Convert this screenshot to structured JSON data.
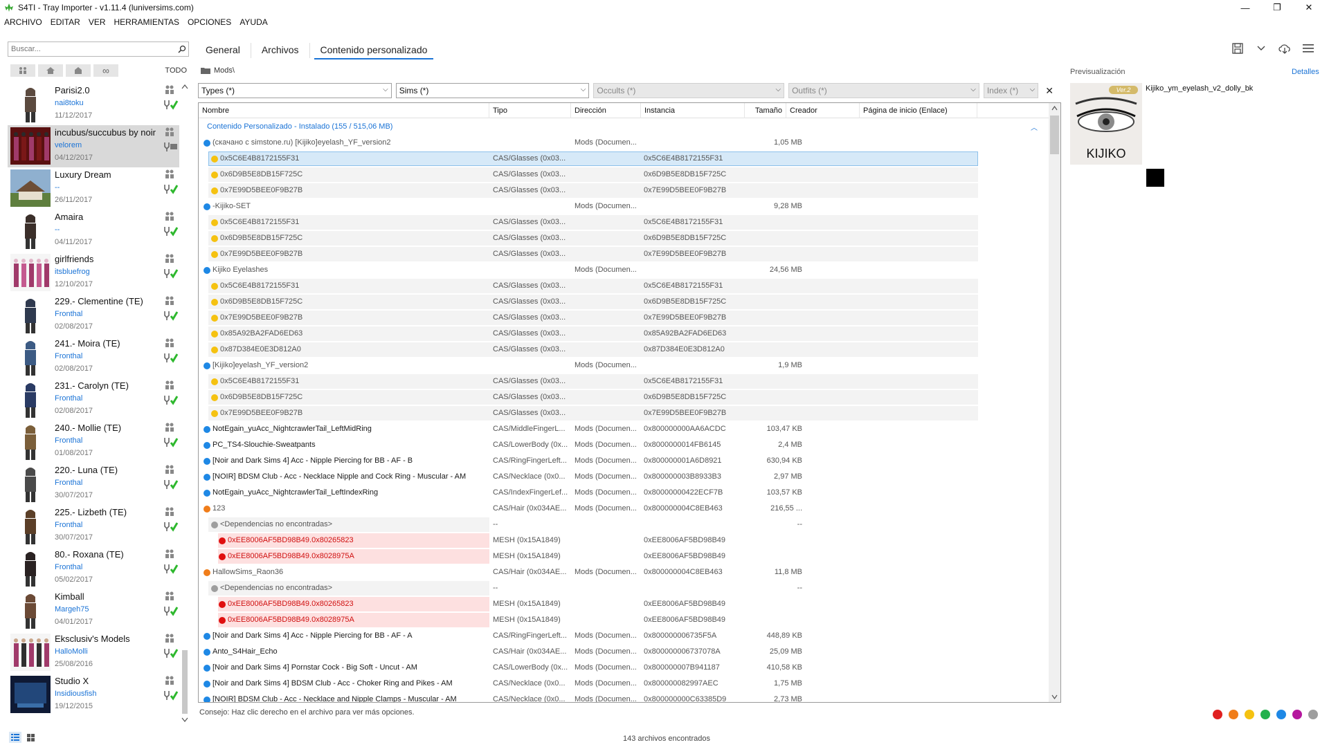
{
  "window": {
    "title": "S4TI - Tray Importer - v1.11.4  (luniversims.com)",
    "controls": [
      "—",
      "❐",
      "✕"
    ]
  },
  "menu": [
    "ARCHIVO",
    "EDITAR",
    "VER",
    "HERRAMIENTAS",
    "OPCIONES",
    "AYUDA"
  ],
  "search": {
    "placeholder": "Buscar..."
  },
  "filter": {
    "todo_label": "TODO"
  },
  "sims": [
    {
      "name": "Parisi2.0",
      "author": "nai8toku",
      "date": "11/12/2017"
    },
    {
      "name": "incubus/succubus by noir",
      "author": "velorem",
      "date": "04/12/2017"
    },
    {
      "name": "Luxury Dream",
      "author": "--",
      "date": "26/11/2017"
    },
    {
      "name": "Amaira",
      "author": "--",
      "date": "04/11/2017"
    },
    {
      "name": "girlfriends",
      "author": "itsbluefrog",
      "date": "12/10/2017"
    },
    {
      "name": "229.- Clementine (TE)",
      "author": "Fronthal",
      "date": "02/08/2017"
    },
    {
      "name": "241.- Moira (TE)",
      "author": "Fronthal",
      "date": "02/08/2017"
    },
    {
      "name": "231.- Carolyn (TE)",
      "author": "Fronthal",
      "date": "02/08/2017"
    },
    {
      "name": "240.- Mollie (TE)",
      "author": "Fronthal",
      "date": "01/08/2017"
    },
    {
      "name": "220.- Luna (TE)",
      "author": "Fronthal",
      "date": "30/07/2017"
    },
    {
      "name": "225.- Lizbeth (TE)",
      "author": "Fronthal",
      "date": "30/07/2017"
    },
    {
      "name": "80.- Roxana (TE)",
      "author": "Fronthal",
      "date": "05/02/2017"
    },
    {
      "name": "Kimball",
      "author": "Margeh75",
      "date": "04/01/2017"
    },
    {
      "name": "Eksclusiv's Models",
      "author": "HalloMolli",
      "date": "25/08/2016"
    },
    {
      "name": "Studio X",
      "author": "Insidiousfish",
      "date": "19/12/2015"
    }
  ],
  "tabs": [
    "General",
    "Archivos",
    "Contenido personalizado"
  ],
  "path": "Mods\\",
  "filters": {
    "types": "Types (*)",
    "sims": "Sims (*)",
    "occults": "Occults (*)",
    "outfits": "Outfits (*)",
    "index": "Index (*)"
  },
  "columns": [
    "Nombre",
    "Tipo",
    "Dirección",
    "Instancia",
    "Tamaño",
    "Creador",
    "Página de inicio (Enlace)"
  ],
  "group": "Contenido Personalizado - Instalado  (155 / 515,06 MB)",
  "rows": [
    {
      "kind": "pkg",
      "color": "#1e88e5",
      "name": "(скачано с simstone.ru) [Kijiko]eyelash_YF_version2",
      "tipo": "",
      "dir": "Mods (Documen...",
      "inst": "",
      "size": "1,05 MB"
    },
    {
      "kind": "child",
      "sel": true,
      "color": "#f5c211",
      "name": "0x5C6E4B8172155F31",
      "tipo": "CAS/Glasses (0x03...",
      "dir": "",
      "inst": "0x5C6E4B8172155F31",
      "size": ""
    },
    {
      "kind": "child",
      "color": "#f5c211",
      "name": "0x6D9B5E8DB15F725C",
      "tipo": "CAS/Glasses (0x03...",
      "dir": "",
      "inst": "0x6D9B5E8DB15F725C",
      "size": ""
    },
    {
      "kind": "child",
      "color": "#f5c211",
      "name": "0x7E99D5BEE0F9B27B",
      "tipo": "CAS/Glasses (0x03...",
      "dir": "",
      "inst": "0x7E99D5BEE0F9B27B",
      "size": ""
    },
    {
      "kind": "pkg",
      "color": "#1e88e5",
      "name": "-Kijiko-SET",
      "tipo": "",
      "dir": "Mods (Documen...",
      "inst": "",
      "size": "9,28 MB"
    },
    {
      "kind": "child",
      "color": "#f5c211",
      "name": "0x5C6E4B8172155F31",
      "tipo": "CAS/Glasses (0x03...",
      "dir": "",
      "inst": "0x5C6E4B8172155F31",
      "size": ""
    },
    {
      "kind": "child",
      "color": "#f5c211",
      "name": "0x6D9B5E8DB15F725C",
      "tipo": "CAS/Glasses (0x03...",
      "dir": "",
      "inst": "0x6D9B5E8DB15F725C",
      "size": ""
    },
    {
      "kind": "child",
      "color": "#f5c211",
      "name": "0x7E99D5BEE0F9B27B",
      "tipo": "CAS/Glasses (0x03...",
      "dir": "",
      "inst": "0x7E99D5BEE0F9B27B",
      "size": ""
    },
    {
      "kind": "pkg",
      "color": "#1e88e5",
      "name": "Kijiko Eyelashes",
      "tipo": "",
      "dir": "Mods (Documen...",
      "inst": "",
      "size": "24,56 MB"
    },
    {
      "kind": "child",
      "color": "#f5c211",
      "name": "0x5C6E4B8172155F31",
      "tipo": "CAS/Glasses (0x03...",
      "dir": "",
      "inst": "0x5C6E4B8172155F31",
      "size": ""
    },
    {
      "kind": "child",
      "color": "#f5c211",
      "name": "0x6D9B5E8DB15F725C",
      "tipo": "CAS/Glasses (0x03...",
      "dir": "",
      "inst": "0x6D9B5E8DB15F725C",
      "size": ""
    },
    {
      "kind": "child",
      "color": "#f5c211",
      "name": "0x7E99D5BEE0F9B27B",
      "tipo": "CAS/Glasses (0x03...",
      "dir": "",
      "inst": "0x7E99D5BEE0F9B27B",
      "size": ""
    },
    {
      "kind": "child",
      "color": "#f5c211",
      "name": "0x85A92BA2FAD6ED63",
      "tipo": "CAS/Glasses (0x03...",
      "dir": "",
      "inst": "0x85A92BA2FAD6ED63",
      "size": ""
    },
    {
      "kind": "child",
      "color": "#f5c211",
      "name": "0x87D384E0E3D812A0",
      "tipo": "CAS/Glasses (0x03...",
      "dir": "",
      "inst": "0x87D384E0E3D812A0",
      "size": ""
    },
    {
      "kind": "pkg",
      "color": "#1e88e5",
      "name": "[Kijiko]eyelash_YF_version2",
      "tipo": "",
      "dir": "Mods (Documen...",
      "inst": "",
      "size": "1,9 MB"
    },
    {
      "kind": "child",
      "color": "#f5c211",
      "name": "0x5C6E4B8172155F31",
      "tipo": "CAS/Glasses (0x03...",
      "dir": "",
      "inst": "0x5C6E4B8172155F31",
      "size": ""
    },
    {
      "kind": "child",
      "color": "#f5c211",
      "name": "0x6D9B5E8DB15F725C",
      "tipo": "CAS/Glasses (0x03...",
      "dir": "",
      "inst": "0x6D9B5E8DB15F725C",
      "size": ""
    },
    {
      "kind": "child",
      "color": "#f5c211",
      "name": "0x7E99D5BEE0F9B27B",
      "tipo": "CAS/Glasses (0x03...",
      "dir": "",
      "inst": "0x7E99D5BEE0F9B27B",
      "size": ""
    },
    {
      "kind": "pkg",
      "color": "#1e88e5",
      "dark": true,
      "name": "NotEgain_yuAcc_NightcrawlerTail_LeftMidRing",
      "tipo": "CAS/MiddleFingerL...",
      "dir": "Mods (Documen...",
      "inst": "0x800000000AA6ACDC",
      "size": "103,47 KB"
    },
    {
      "kind": "pkg",
      "color": "#1e88e5",
      "dark": true,
      "name": "PC_TS4-Slouchie-Sweatpants",
      "tipo": "CAS/LowerBody (0x...",
      "dir": "Mods (Documen...",
      "inst": "0x8000000014FB6145",
      "size": "2,4 MB"
    },
    {
      "kind": "pkg",
      "color": "#1e88e5",
      "dark": true,
      "name": "[Noir and Dark Sims 4] Acc - Nipple Piercing for BB - AF - B",
      "tipo": "CAS/RingFingerLeft...",
      "dir": "Mods (Documen...",
      "inst": "0x800000001A6D8921",
      "size": "630,94 KB"
    },
    {
      "kind": "pkg",
      "color": "#1e88e5",
      "dark": true,
      "name": "[NOIR] BDSM Club - Acc - Necklace Nipple and Cock Ring - Muscular - AM",
      "tipo": "CAS/Necklace (0x0...",
      "dir": "Mods (Documen...",
      "inst": "0x800000003B8933B3",
      "size": "2,97 MB"
    },
    {
      "kind": "pkg",
      "color": "#1e88e5",
      "dark": true,
      "name": "NotEgain_yuAcc_NightcrawlerTail_LeftIndexRing",
      "tipo": "CAS/IndexFingerLef...",
      "dir": "Mods (Documen...",
      "inst": "0x80000000422ECF7B",
      "size": "103,57 KB"
    },
    {
      "kind": "pkg",
      "color": "#f07d1a",
      "name": "123",
      "tipo": "CAS/Hair (0x034AE...",
      "dir": "Mods (Documen...",
      "inst": "0x800000004C8EB463",
      "size": "216,55 ..."
    },
    {
      "kind": "dep",
      "color": "#9e9e9e",
      "name": "<Dependencias no encontradas>",
      "tipo": "--",
      "dir": "",
      "inst": "",
      "size": "--"
    },
    {
      "kind": "err",
      "color": "#e01010",
      "name": "0xEE8006AF5BD98B49.0x80265823",
      "tipo": "MESH (0x15A1849)",
      "dir": "",
      "inst": "0xEE8006AF5BD98B49",
      "size": ""
    },
    {
      "kind": "err",
      "color": "#e01010",
      "name": "0xEE8006AF5BD98B49.0x8028975A",
      "tipo": "MESH (0x15A1849)",
      "dir": "",
      "inst": "0xEE8006AF5BD98B49",
      "size": ""
    },
    {
      "kind": "pkg",
      "color": "#f07d1a",
      "name": "HallowSims_Raon36",
      "tipo": "CAS/Hair (0x034AE...",
      "dir": "Mods (Documen...",
      "inst": "0x800000004C8EB463",
      "size": "11,8 MB"
    },
    {
      "kind": "dep",
      "color": "#9e9e9e",
      "name": "<Dependencias no encontradas>",
      "tipo": "--",
      "dir": "",
      "inst": "",
      "size": "--"
    },
    {
      "kind": "err",
      "color": "#e01010",
      "name": "0xEE8006AF5BD98B49.0x80265823",
      "tipo": "MESH (0x15A1849)",
      "dir": "",
      "inst": "0xEE8006AF5BD98B49",
      "size": ""
    },
    {
      "kind": "err",
      "color": "#e01010",
      "name": "0xEE8006AF5BD98B49.0x8028975A",
      "tipo": "MESH (0x15A1849)",
      "dir": "",
      "inst": "0xEE8006AF5BD98B49",
      "size": ""
    },
    {
      "kind": "pkg",
      "color": "#1e88e5",
      "dark": true,
      "name": "[Noir and Dark Sims 4] Acc - Nipple Piercing for BB - AF - A",
      "tipo": "CAS/RingFingerLeft...",
      "dir": "Mods (Documen...",
      "inst": "0x800000006735F5A",
      "size": "448,89 KB"
    },
    {
      "kind": "pkg",
      "color": "#1e88e5",
      "dark": true,
      "name": "Anto_S4Hair_Echo",
      "tipo": "CAS/Hair (0x034AE...",
      "dir": "Mods (Documen...",
      "inst": "0x800000006737078A",
      "size": "25,09 MB"
    },
    {
      "kind": "pkg",
      "color": "#1e88e5",
      "dark": true,
      "name": "[Noir and Dark Sims 4] Pornstar Cock - Big Soft - Uncut - AM",
      "tipo": "CAS/LowerBody (0x...",
      "dir": "Mods (Documen...",
      "inst": "0x800000007B941187",
      "size": "410,58 KB"
    },
    {
      "kind": "pkg",
      "color": "#1e88e5",
      "dark": true,
      "name": "[Noir and Dark Sims 4] BDSM Club - Acc - Choker Ring and Pikes - AM",
      "tipo": "CAS/Necklace (0x0...",
      "dir": "Mods (Documen...",
      "inst": "0x800000082997AEC",
      "size": "1,75 MB"
    },
    {
      "kind": "pkg",
      "color": "#1e88e5",
      "dark": true,
      "name": "[NOIR] BDSM Club - Acc - Necklace and Nipple Clamps - Muscular - AM",
      "tipo": "CAS/Necklace (0x0...",
      "dir": "Mods (Documen...",
      "inst": "0x800000000C63385D9",
      "size": "2,73 MB"
    }
  ],
  "hint": "Consejo:  Haz clic derecho en el archivo para ver más opciones.",
  "status": "143 archivos encontrados",
  "preview": {
    "label": "Previsualización",
    "details": "Detalles",
    "name": "Kijiko_ym_eyelash_v2_dolly_bk",
    "brand": "KIJIKO",
    "ver": "Ver.2"
  },
  "color_dots": [
    "#e02020",
    "#f07d1a",
    "#f5c211",
    "#22b14c",
    "#1e88e5",
    "#b5179e",
    "#9e9e9e"
  ]
}
